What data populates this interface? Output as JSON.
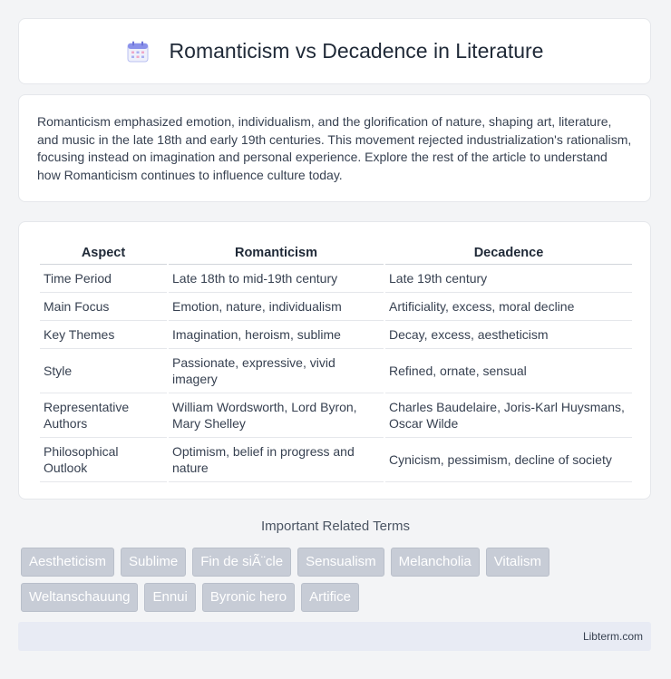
{
  "header": {
    "icon": "calendar-icon",
    "title": "Romanticism vs Decadence in Literature"
  },
  "intro": {
    "text": "Romanticism emphasized emotion, individualism, and the glorification of nature, shaping art, literature, and music in the late 18th and early 19th centuries. This movement rejected industrialization's rationalism, focusing instead on imagination and personal experience. Explore the rest of the article to understand how Romanticism continues to influence culture today."
  },
  "table": {
    "headers": [
      "Aspect",
      "Romanticism",
      "Decadence"
    ],
    "rows": [
      [
        "Time Period",
        "Late 18th to mid-19th century",
        "Late 19th century"
      ],
      [
        "Main Focus",
        "Emotion, nature, individualism",
        "Artificiality, excess, moral decline"
      ],
      [
        "Key Themes",
        "Imagination, heroism, sublime",
        "Decay, excess, aestheticism"
      ],
      [
        "Style",
        "Passionate, expressive, vivid imagery",
        "Refined, ornate, sensual"
      ],
      [
        "Representative Authors",
        "William Wordsworth, Lord Byron, Mary Shelley",
        "Charles Baudelaire, Joris-Karl Huysmans, Oscar Wilde"
      ],
      [
        "Philosophical Outlook",
        "Optimism, belief in progress and nature",
        "Cynicism, pessimism, decline of society"
      ]
    ]
  },
  "related": {
    "title": "Important Related Terms",
    "tags": [
      "Aestheticism",
      "Sublime",
      "Fin de siÃ¨cle",
      "Sensualism",
      "Melancholia",
      "Vitalism",
      "Weltanschauung",
      "Ennui",
      "Byronic hero",
      "Artifice"
    ]
  },
  "footer": {
    "brand": "Libterm.com"
  },
  "colors": {
    "icon_accent": "#7c83e6",
    "tag_bg": "#c7ccd6"
  }
}
